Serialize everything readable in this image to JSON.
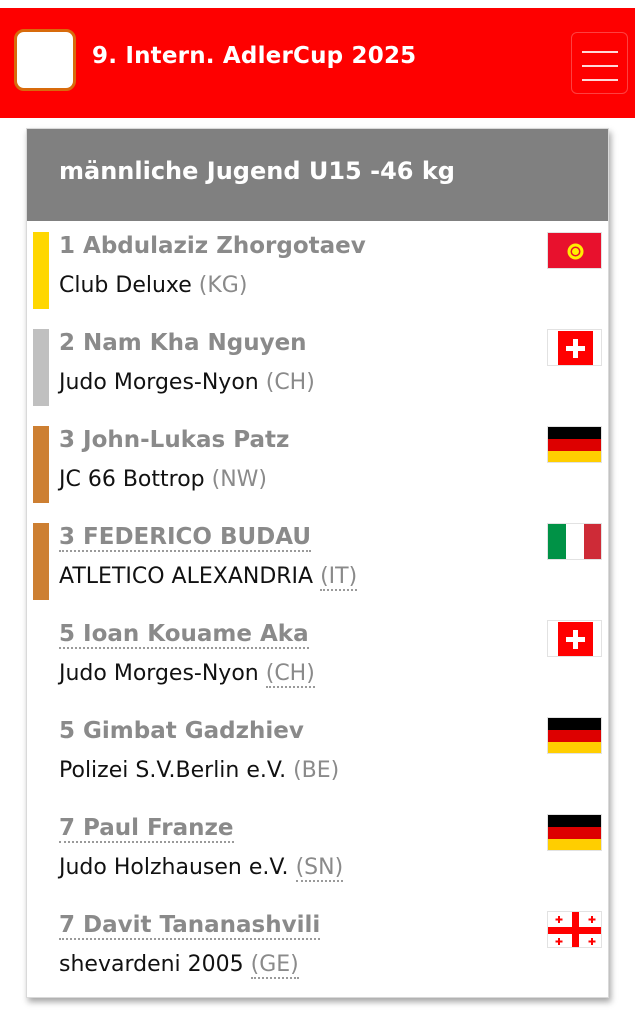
{
  "header": {
    "title": "9. Intern. AdlerCup 2025",
    "brand_color": "#fe0000"
  },
  "category": {
    "title": "männliche Jugend U15 -46 kg"
  },
  "results": [
    {
      "rank": "1",
      "name": "Abdulaziz Zhorgotaev",
      "club": "Club Deluxe",
      "region": "(KG)",
      "medal_color": "#ffd700",
      "flag_icon": "kyrgyzstan-flag-icon"
    },
    {
      "rank": "2",
      "name": "Nam Kha Nguyen",
      "club": "Judo Morges-Nyon",
      "region": "(CH)",
      "medal_color": "#c0c0c0",
      "flag_icon": "switzerland-flag-icon"
    },
    {
      "rank": "3",
      "name": "John-Lukas Patz",
      "club": "JC 66 Bottrop",
      "region": "(NW)",
      "medal_color": "#cd7f32",
      "flag_icon": "germany-flag-icon"
    },
    {
      "rank": "3",
      "name": "FEDERICO BUDAU",
      "club": "ATLETICO ALEXANDRIA",
      "region": "(IT)",
      "medal_color": "#cd7f32",
      "flag_icon": "italy-flag-icon"
    },
    {
      "rank": "5",
      "name": "Ioan Kouame Aka",
      "club": "Judo Morges-Nyon",
      "region": "(CH)",
      "flag_icon": "switzerland-flag-icon"
    },
    {
      "rank": "5",
      "name": "Gimbat Gadzhiev",
      "club": "Polizei S.V.Berlin e.V.",
      "region": "(BE)",
      "flag_icon": "germany-flag-icon"
    },
    {
      "rank": "7",
      "name": "Paul Franze",
      "club": "Judo Holzhausen e.V.",
      "region": "(SN)",
      "flag_icon": "germany-flag-icon"
    },
    {
      "rank": "7",
      "name": "Davit Tananashvili",
      "club": "shevardeni 2005",
      "region": "(GE)",
      "flag_icon": "georgia-flag-icon"
    }
  ]
}
